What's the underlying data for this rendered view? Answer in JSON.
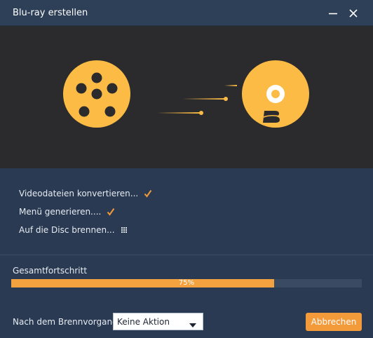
{
  "window": {
    "title": "Blu-ray erstellen",
    "minimize_icon": "minimize-icon",
    "close_icon": "close-icon"
  },
  "animation": {
    "source_icon": "film-reel-icon",
    "target_icon": "bluray-disc-icon",
    "accent_color": "#fbbb45",
    "background_color": "#2b2b2d"
  },
  "steps": [
    {
      "label": "Videodateien konvertieren...",
      "status": "done",
      "icon": "checkmark-icon"
    },
    {
      "label": "Menü generieren....",
      "status": "done",
      "icon": "checkmark-icon"
    },
    {
      "label": "Auf die Disc brennen...",
      "status": "in-progress",
      "icon": "loading-dots-icon"
    }
  ],
  "progress": {
    "label": "Gesamtfortschritt",
    "percent": 75,
    "percent_text": "75%",
    "fill_color": "#f3a23f"
  },
  "footer": {
    "after_burn_label": "Nach dem Brennvorgang:",
    "after_burn_selected": "Keine Aktion",
    "cancel_label": "Abbrechen"
  }
}
